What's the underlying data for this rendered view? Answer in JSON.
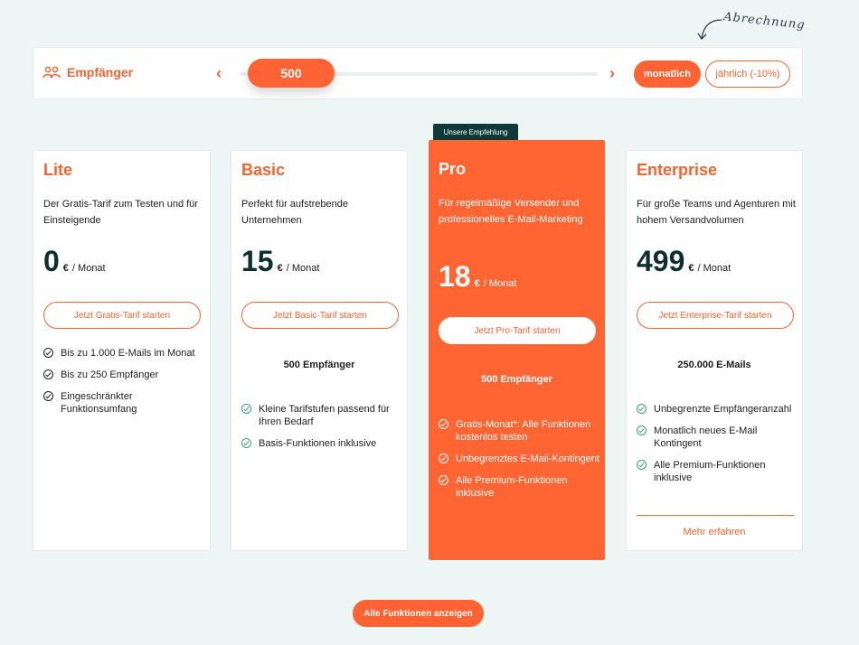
{
  "hint": {
    "text": "Abrechnung"
  },
  "recipients": {
    "label": "Empfänger",
    "value": "500",
    "prev_icon": "chevron-left-icon",
    "next_icon": "chevron-right-icon"
  },
  "billing": {
    "monthly": "monatlich",
    "yearly": "jährlich (-10%)",
    "selected": "monatlich"
  },
  "recommend_badge": "Unsere Empfehlung",
  "plans": [
    {
      "title": "Lite",
      "desc": "Der Gratis-Tarif zum Testen und für Einsteigende",
      "price": "0",
      "currency": "€",
      "unit": "/ Monat",
      "button": "Jetzt Gratis-Tarif starten",
      "features": [
        "Bis zu 1.000 E-Mails im Monat",
        "Bis zu 250 Empfänger",
        "Eingeschränkter Funktionsumfang"
      ]
    },
    {
      "title": "Basic",
      "desc": "Perfekt für aufstrebende Unternehmen",
      "price": "15",
      "currency": "€",
      "unit": "/ Monat",
      "button": "Jetzt Basic-Tarif starten",
      "count": "500 Empfänger",
      "features": [
        "Kleine Tarifstufen passend für Ihren Bedarf",
        "Basis-Funktionen inklusive"
      ]
    },
    {
      "title": "Pro",
      "desc": "Für regelmäßige Versender und professionelles E-Mail-Marketing",
      "price": "18",
      "currency": "€",
      "unit": "/ Monat",
      "button": "Jetzt Pro-Tarif starten",
      "count": "500 Empfänger",
      "features": [
        "Gratis-Monat*: Alle Funktionen kostenlos testen",
        "Unbegrenztes E-Mail-Kontingent",
        "Alle Premium-Funktionen inklusive"
      ]
    },
    {
      "title": "Enterprise",
      "desc": "Für große Teams und Agenturen mit hohem Versandvolumen",
      "price": "499",
      "currency": "€",
      "unit": "/ Monat",
      "button": "Jetzt Enterprise-Tarif starten",
      "count": "250.000 E-Mails",
      "features": [
        "Unbegrenzte Empfängeranzahl",
        "Monatlich neues E-Mail Kontingent",
        "Alle Premium-Funktionen inklusive"
      ],
      "more": "Mehr erfahren"
    }
  ],
  "all_features_button": "Alle Funktionen anzeigen",
  "colors": {
    "accent": "#ff6233",
    "dark": "#0f2f2f",
    "check_green": "#3aa36b"
  }
}
